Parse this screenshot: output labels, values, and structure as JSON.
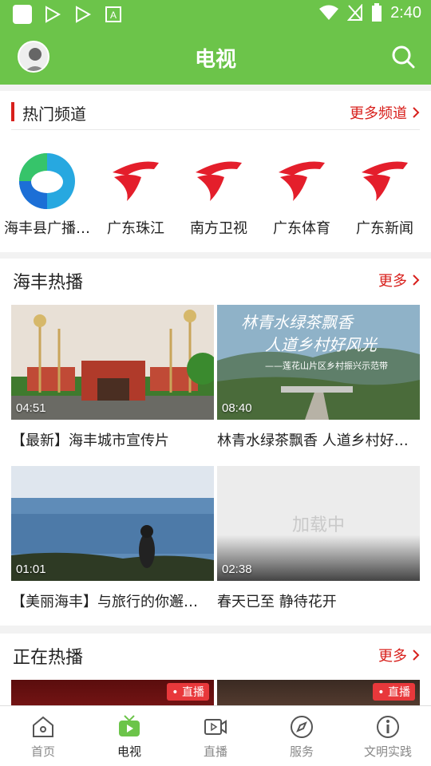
{
  "status": {
    "time": "2:40"
  },
  "header": {
    "title": "电视"
  },
  "hot_channels": {
    "title": "热门频道",
    "more_label": "更多频道",
    "items": [
      {
        "name": "海丰县广播…",
        "logo": "haifeng-logo"
      },
      {
        "name": "广东珠江",
        "logo": "guangdong-tv-logo"
      },
      {
        "name": "南方卫视",
        "logo": "guangdong-tv-logo"
      },
      {
        "name": "广东体育",
        "logo": "guangdong-tv-logo"
      },
      {
        "name": "广东新闻",
        "logo": "guangdong-tv-logo"
      }
    ]
  },
  "haifeng_hot": {
    "title": "海丰热播",
    "more_label": "更多",
    "videos": [
      {
        "caption": "【最新】海丰城市宣传片",
        "duration": "04:51"
      },
      {
        "caption": "林青水绿茶飘香 人道乡村好…",
        "duration": "08:40",
        "overlay_line1": "林青水绿茶飘香",
        "overlay_line2": "人道乡村好风光",
        "overlay_sub": "——莲花山片区乡村振兴示范带"
      },
      {
        "caption": "【美丽海丰】与旅行的你邂…",
        "duration": "01:01"
      },
      {
        "caption": "春天已至 静待花开",
        "duration": "02:38",
        "loading": "加载中"
      }
    ]
  },
  "now_playing": {
    "title": "正在热播",
    "more_label": "更多",
    "items": [
      {
        "badge": "• 直播"
      },
      {
        "badge": "• 直播"
      }
    ]
  },
  "bottom_nav": [
    {
      "label": "首页",
      "icon": "home-icon"
    },
    {
      "label": "电视",
      "icon": "tv-icon",
      "active": true
    },
    {
      "label": "直播",
      "icon": "live-icon"
    },
    {
      "label": "服务",
      "icon": "compass-icon"
    },
    {
      "label": "文明实践",
      "icon": "info-icon"
    }
  ],
  "colors": {
    "primary": "#6cc44a",
    "accent": "#d8201c",
    "live": "#e8383b"
  }
}
